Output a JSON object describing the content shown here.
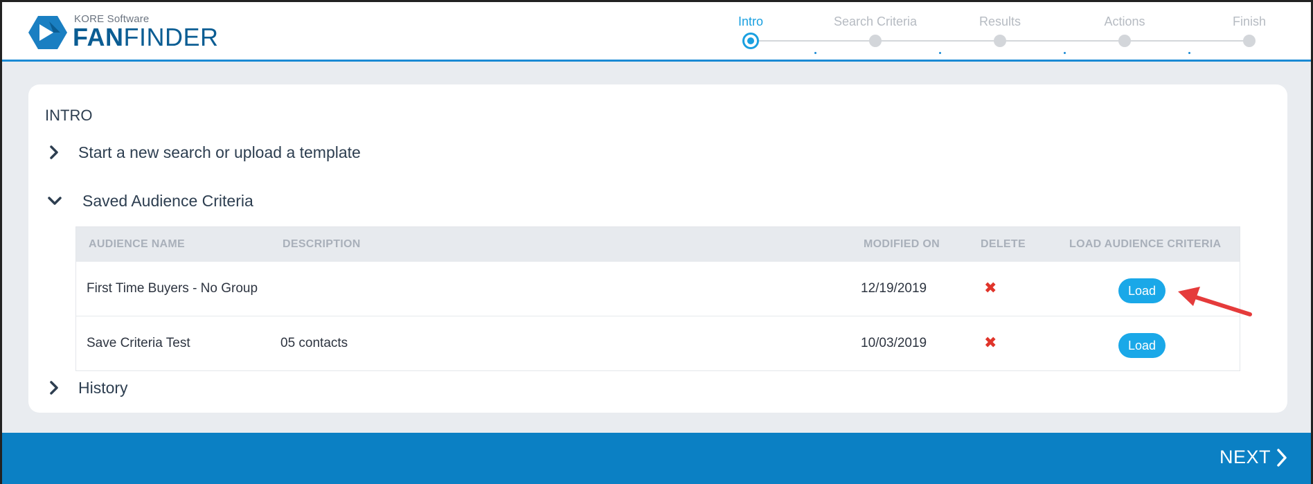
{
  "brand": {
    "company": "KORE Software",
    "product_bold": "FAN",
    "product_light": "FINDER"
  },
  "stepper": {
    "steps": [
      {
        "label": "Intro",
        "state": "active"
      },
      {
        "label": "Search Criteria",
        "state": "pending"
      },
      {
        "label": "Results",
        "state": "pending"
      },
      {
        "label": "Actions",
        "state": "pending"
      },
      {
        "label": "Finish",
        "state": "pending"
      }
    ]
  },
  "main": {
    "title": "INTRO",
    "sections": {
      "new_search": "Start a new search or upload a template",
      "saved": "Saved Audience Criteria",
      "history": "History"
    },
    "table": {
      "headers": [
        "AUDIENCE NAME",
        "DESCRIPTION",
        "MODIFIED ON",
        "DELETE",
        "LOAD AUDIENCE CRITERIA"
      ],
      "rows": [
        {
          "name": "First Time Buyers - No Group",
          "description": "",
          "modified": "12/19/2019",
          "load": "Load"
        },
        {
          "name": "Save Criteria Test",
          "description": "05 contacts",
          "modified": "10/03/2019",
          "load": "Load"
        }
      ]
    }
  },
  "footer": {
    "next": "NEXT"
  },
  "colors": {
    "accent": "#1aa0e0",
    "footer": "#0b80c4",
    "brand": "#0b5d93",
    "delete": "#e0342a",
    "annotation": "#e53b3b"
  }
}
